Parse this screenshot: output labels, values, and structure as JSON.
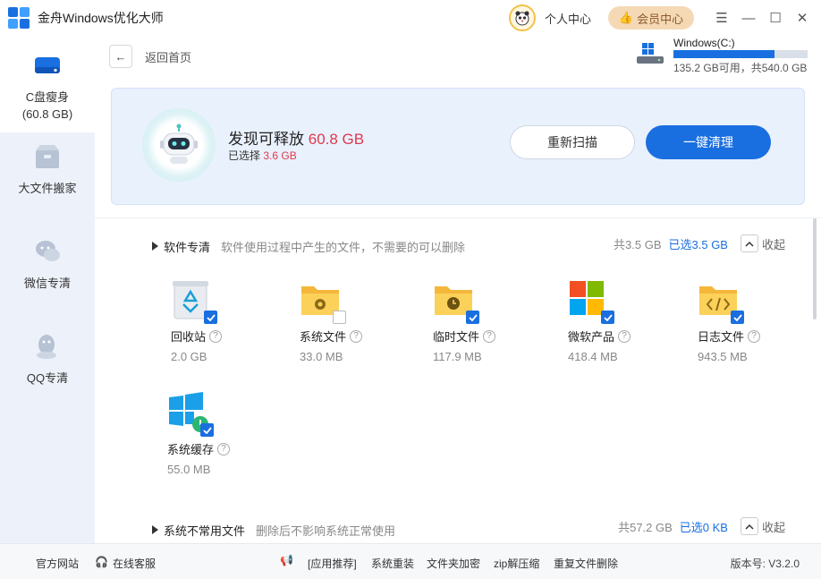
{
  "app": {
    "title": "金舟Windows优化大师"
  },
  "header": {
    "personal_center": "个人中心",
    "vip_center": "会员中心"
  },
  "sidebar": {
    "items": [
      {
        "label": "C盘瘦身",
        "sublabel": "(60.8 GB)"
      },
      {
        "label": "大文件搬家"
      },
      {
        "label": "微信专清"
      },
      {
        "label": "QQ专清"
      }
    ]
  },
  "topbar": {
    "back_label": "返回首页",
    "drive_name": "Windows(C:)",
    "drive_usage": "135.2 GB可用，共540.0 GB",
    "drive_used_fraction": 0.75
  },
  "scan": {
    "found_prefix": "发现可释放",
    "found_value": "60.8 GB",
    "selected_prefix": "已选择",
    "selected_value": "3.6 GB",
    "rescan_label": "重新扫描",
    "clean_label": "一键清理"
  },
  "section1": {
    "title": "软件专清",
    "desc": "软件使用过程中产生的文件，不需要的可以删除",
    "total": "共3.5 GB",
    "selected": "已选3.5 GB",
    "collapse": "收起",
    "items": [
      {
        "name": "回收站",
        "size": "2.0 GB",
        "checked": true
      },
      {
        "name": "系统文件",
        "size": "33.0 MB",
        "checked": false
      },
      {
        "name": "临时文件",
        "size": "117.9 MB",
        "checked": true
      },
      {
        "name": "微软产品",
        "size": "418.4 MB",
        "checked": true
      },
      {
        "name": "日志文件",
        "size": "943.5 MB",
        "checked": true
      },
      {
        "name": "系统缓存",
        "size": "55.0 MB",
        "checked": true
      }
    ]
  },
  "section2": {
    "title": "系统不常用文件",
    "desc": "删除后不影响系统正常使用",
    "total": "共57.2 GB",
    "selected": "已选0 KB",
    "collapse": "收起"
  },
  "footer": {
    "official_site": "官方网站",
    "online_service": "在线客服",
    "app_recommend": "[应用推荐]",
    "sys_reinstall": "系统重装",
    "folder_encrypt": "文件夹加密",
    "zip": "zip解压缩",
    "dup_delete": "重复文件删除",
    "version": "版本号: V3.2.0"
  },
  "colors": {
    "accent": "#1a6fe0",
    "highlight": "#e0384d",
    "sidebar_bg": "#edf2fa"
  }
}
